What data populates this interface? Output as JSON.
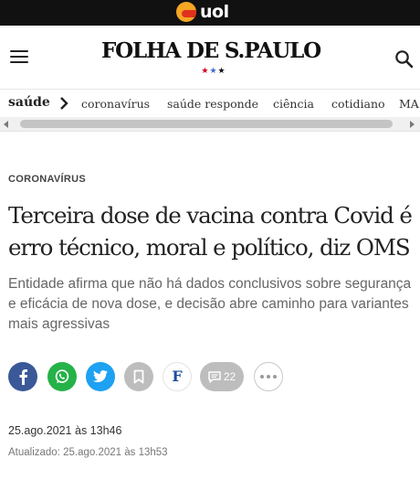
{
  "top_bar": {
    "brand": "uol"
  },
  "header": {
    "logo": "FOLHA DE S.PAULO",
    "stars": [
      "★",
      "★",
      "★"
    ],
    "menu_icon": "hamburger-menu-icon",
    "search_icon": "search-icon"
  },
  "section_nav": {
    "current": "saúde",
    "links": [
      "coronavírus",
      "saúde responde",
      "ciência",
      "cotidiano",
      "MA"
    ]
  },
  "article": {
    "kicker": "CORONAVÍRUS",
    "headline": "Terceira dose de vacina contra Covid é erro técnico, moral e político, diz OMS",
    "standfirst": "Entidade afirma que não há dados conclusivos sobre segurança e eficácia de nova dose, e decisão abre caminho para variantes mais agressivas",
    "published": "25.ago.2021 às 13h46",
    "updated": "Atualizado: 25.ago.2021 às 13h53"
  },
  "share": {
    "folha_label": "F",
    "comment_count": "22",
    "icons": [
      "facebook-icon",
      "whatsapp-icon",
      "twitter-icon",
      "bookmark-icon",
      "folha-icon",
      "comment-icon",
      "more-icon"
    ]
  },
  "colors": {
    "uol_bar": "#111111",
    "facebook": "#3b5998",
    "whatsapp": "#25b248",
    "twitter": "#1da1f2",
    "neutral_button": "#bdbdbd",
    "star_red": "#d0021b",
    "star_blue": "#3f6ad8"
  }
}
